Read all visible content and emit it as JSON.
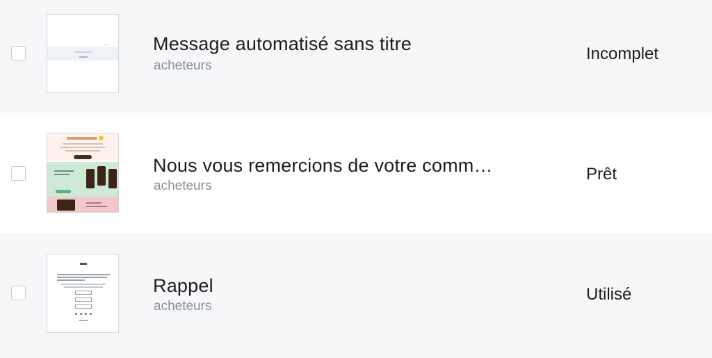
{
  "rows": [
    {
      "title": "Message automatisé sans titre",
      "subtitle": "acheteurs",
      "status": "Incomplet"
    },
    {
      "title": "Nous vous remercions de votre comm…",
      "subtitle": "acheteurs",
      "status": "Prêt"
    },
    {
      "title": "Rappel",
      "subtitle": "acheteurs",
      "status": "Utilisé"
    }
  ]
}
